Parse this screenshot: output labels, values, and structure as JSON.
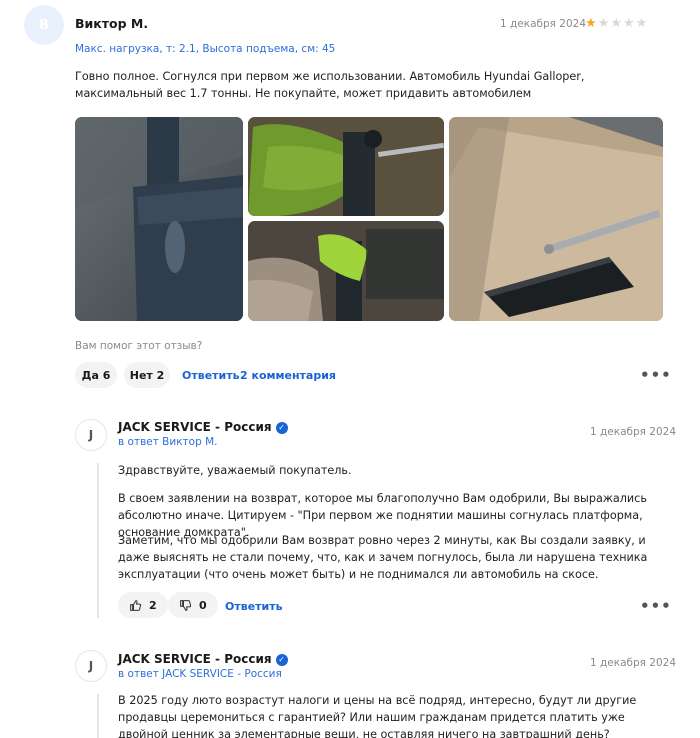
{
  "review": {
    "avatar_letter": "В",
    "author": "Виктор М.",
    "date": "1 декабря 2024",
    "rating": 1,
    "rating_max": 5,
    "specs": "Макс. нагрузка, т: 2.1, Высота подъема, см: 45",
    "text": "Говно полное. Согнулся при первом же использовании. Автомобиль Hyundai Galloper, максимальный вес 1.7 тонны. Не покупайте, может придавить автомобилем",
    "helpful_question": "Вам помог этот отзыв?",
    "yes_label": "Да 6",
    "no_label": "Нет 2",
    "reply_label": "Ответить",
    "comments_label": "2 комментария"
  },
  "comments": [
    {
      "avatar_letter": "J",
      "author": "JACK SERVICE - Россия",
      "in_reply_to": "в ответ Виктор М.",
      "date": "1 декабря 2024",
      "p1": "Здравствуйте, уважаемый покупатель.",
      "p2": "В своем заявлении на возврат, которое мы благополучно Вам одобрили, Вы выражались абсолютно иначе. Цитируем - \"При первом же поднятии машины согнулась платформа, основание домкрата\".",
      "p3": "Заметим, что мы одобрили Вам возврат ровно через 2 минуты, как Вы создали заявку, и даже выяснять не стали почему, что, как и зачем погнулось, была ли нарушена техника эксплуатации (что очень может быть) и не поднимался ли автомобиль на скосе.",
      "likes": "2",
      "dislikes": "0",
      "reply_label": "Ответить"
    },
    {
      "avatar_letter": "J",
      "author": "JACK SERVICE - Россия",
      "in_reply_to": "в ответ JACK SERVICE - Россия",
      "date": "1 декабря 2024",
      "p1": "В 2025 году люто возрастут налоги и цены на всё подряд, интересно, будут ли другие продавцы церемониться с гарантией? Или нашим гражданам придется платить уже двойной ценник за элементарные вещи, не оставляя ничего на завтрашний день?"
    }
  ],
  "icons": {
    "verified": "verified-check-icon",
    "like": "thumb-up-icon",
    "dislike": "thumb-down-icon",
    "more": "more-dots-icon"
  },
  "colors": {
    "link": "#1a63d6",
    "star_on": "#f5a623",
    "star_off": "#d9d9d9"
  }
}
